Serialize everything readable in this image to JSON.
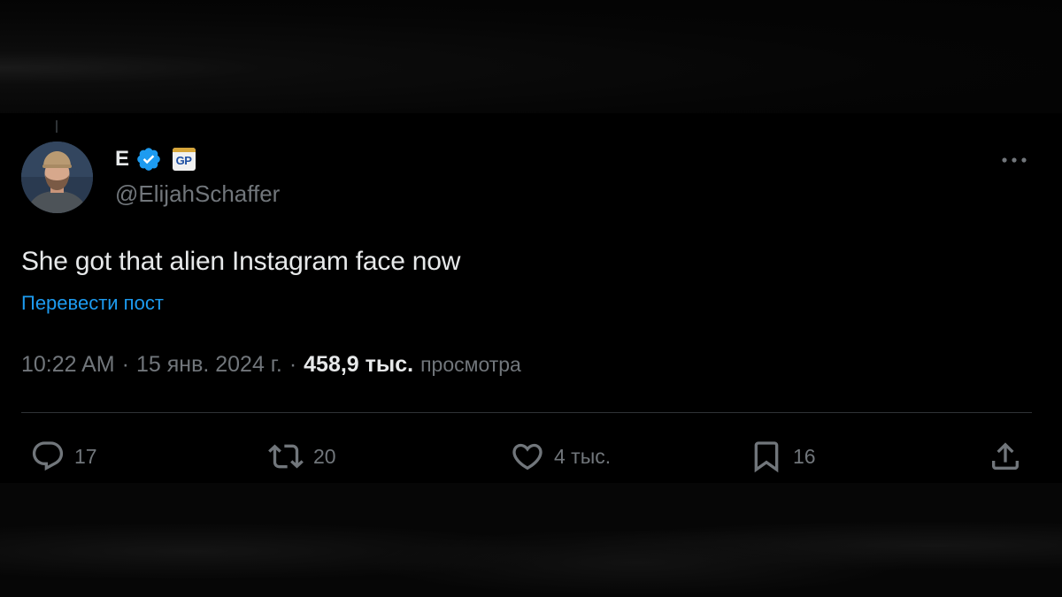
{
  "author": {
    "display_name": "E",
    "verified": true,
    "affiliate_badge": "GP",
    "handle": "@ElijahSchaffer"
  },
  "post": {
    "text": "She got that alien Instagram face now",
    "translate_link": "Перевести пост",
    "time": "10:22 AM",
    "date": "15 янв. 2024 г.",
    "separator": "·",
    "views_count": "458,9 тыс.",
    "views_label": "просмотра"
  },
  "actions": {
    "replies": "17",
    "reposts": "20",
    "likes": "4 тыс.",
    "bookmarks": "16"
  },
  "icons": {
    "more": "more-horizontal-icon",
    "reply": "reply-icon",
    "repost": "repost-icon",
    "like": "heart-icon",
    "bookmark": "bookmark-icon",
    "share": "share-icon",
    "verified": "verified-badge-icon"
  },
  "colors": {
    "background": "#000000",
    "text_primary": "#e7e9ea",
    "text_secondary": "#71767b",
    "link": "#1d9bf0",
    "verified": "#1d9bf0",
    "divider": "#2f3336"
  }
}
